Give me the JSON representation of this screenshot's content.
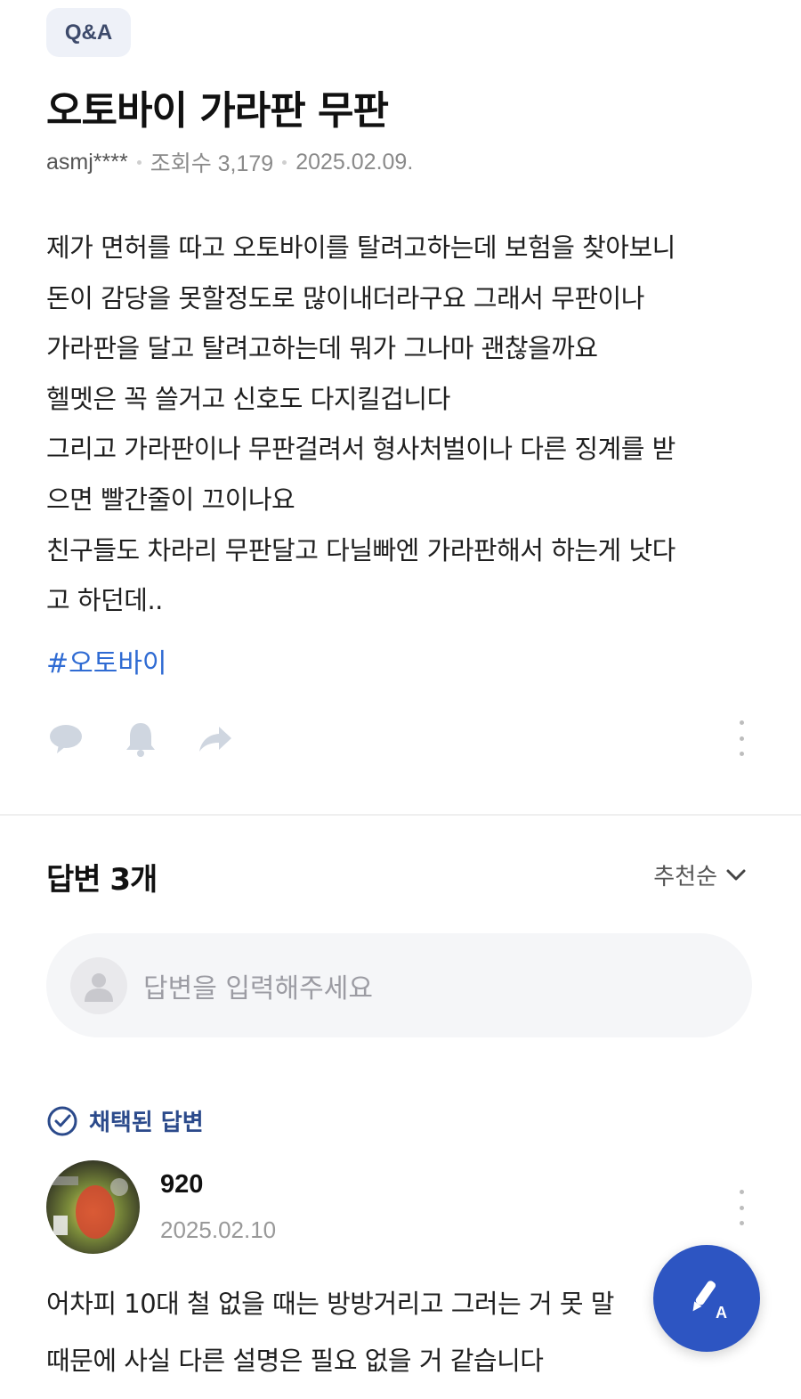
{
  "post": {
    "category_badge": "Q&A",
    "title": "오토바이 가라판 무판",
    "author": "asmj****",
    "views": "조회수 3,179",
    "date": "2025.02.09.",
    "body_lines": [
      "제가 면허를 따고 오토바이를 탈려고하는데 보험을 찾아보니",
      "돈이 감당을 못할정도로 많이내더라구요 그래서 무판이나",
      "가라판을 달고 탈려고하는데 뭐가 그나마 괜찮을까요",
      "헬멧은 꼭 쓸거고 신호도 다지킬겁니다",
      "그리고 가라판이나 무판걸려서 형사처벌이나 다른 징계를 받",
      "으면 빨간줄이 끄이나요",
      "친구들도 차라리 무판달고 다닐빠엔 가라판해서 하는게 낫다",
      "고 하던데.."
    ],
    "hashtag": "#오토바이",
    "action_icons": [
      "comment-icon",
      "bell-icon",
      "share-icon",
      "more-vertical-icon"
    ]
  },
  "answers": {
    "count_label": "답변 3개",
    "sort_label": "추천순",
    "input_placeholder": "답변을 입력해주세요",
    "adopted_label": "채택된 답변",
    "first": {
      "name": "920",
      "date": "2025.02.10",
      "text_lines": [
        "어차피 10대 철 없을 때는 방방거리고 그러는 거 못 말",
        "때문에 사실 다른 설명은 필요 없을 거 같습니다"
      ]
    }
  },
  "colors": {
    "accent_blue": "#2f6bd3",
    "adopted_navy": "#2b4a8b",
    "fab_blue": "#2d55c2",
    "icon_gray": "#cfd6e0"
  }
}
